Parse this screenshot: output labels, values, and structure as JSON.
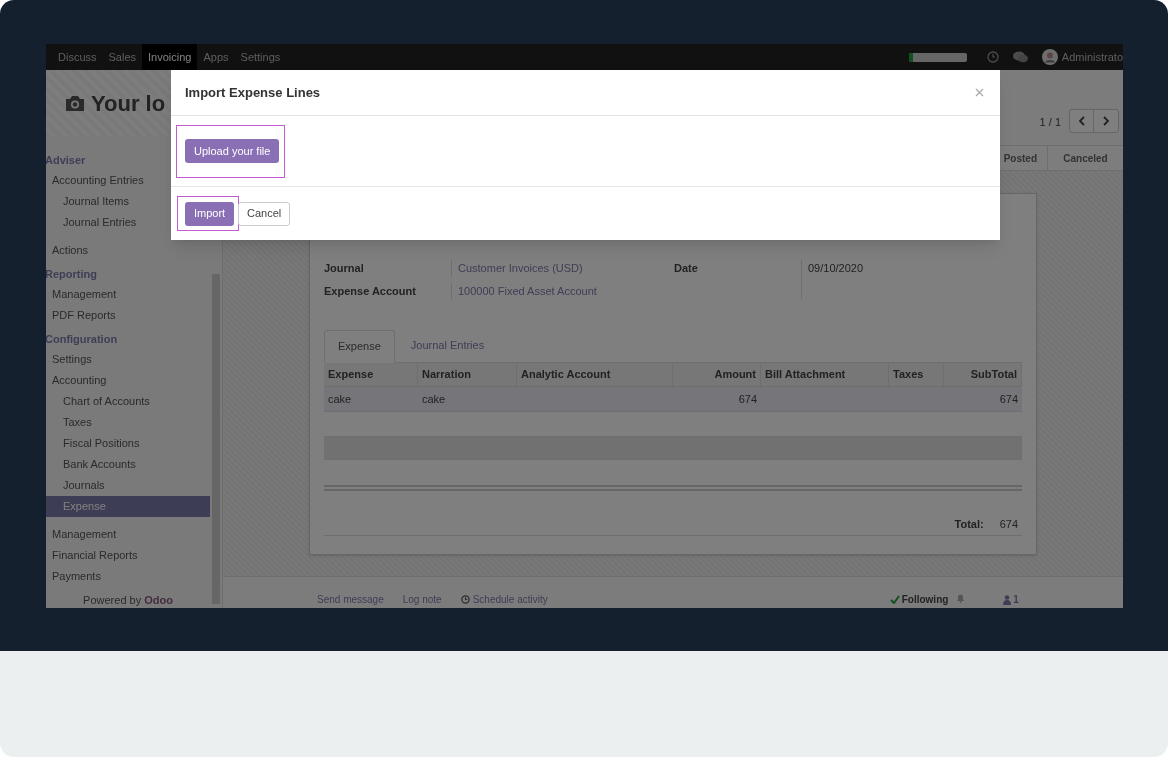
{
  "navbar": {
    "apps": [
      {
        "label": "Discuss",
        "selected": false
      },
      {
        "label": "Sales",
        "selected": false
      },
      {
        "label": "Invoicing",
        "selected": true
      },
      {
        "label": "Apps",
        "selected": false
      },
      {
        "label": "Settings",
        "selected": false
      }
    ],
    "progress": {
      "level": 0.07
    },
    "user": "Administrato"
  },
  "logo_text": "Your lo",
  "sidebar": {
    "sections": [
      {
        "title": "Adviser",
        "items": [
          {
            "label": "Accounting Entries",
            "selected": false,
            "children": [
              {
                "label": "Journal Items",
                "selected": false
              },
              {
                "label": "Journal Entries",
                "selected": false
              }
            ]
          },
          {
            "label": "Actions",
            "selected": false
          }
        ]
      },
      {
        "title": "Reporting",
        "items": [
          {
            "label": "Management",
            "selected": false
          },
          {
            "label": "PDF Reports",
            "selected": false
          }
        ]
      },
      {
        "title": "Configuration",
        "items": [
          {
            "label": "Settings",
            "selected": false
          },
          {
            "label": "Accounting",
            "selected": false,
            "children": [
              {
                "label": "Chart of Accounts",
                "selected": false
              },
              {
                "label": "Taxes",
                "selected": false
              },
              {
                "label": "Fiscal Positions",
                "selected": false
              },
              {
                "label": "Bank Accounts",
                "selected": false
              },
              {
                "label": "Journals",
                "selected": false
              },
              {
                "label": "Expense",
                "selected": true
              }
            ]
          },
          {
            "label": "Management",
            "selected": false
          },
          {
            "label": "Financial Reports",
            "selected": false
          },
          {
            "label": "Payments",
            "selected": false
          }
        ]
      }
    ],
    "footer_text": "Powered by",
    "footer_brand": "Odoo"
  },
  "pager": "1 / 1",
  "stages": [
    {
      "label": "Posted",
      "selected": false
    },
    {
      "label": "Canceled",
      "selected": false
    }
  ],
  "form": {
    "left_fields": [
      {
        "label": "Journal",
        "value": "Customer Invoices (USD)"
      },
      {
        "label": "Expense Account",
        "value": "100000 Fixed Asset Account"
      }
    ],
    "right_fields": [
      {
        "label": "Date",
        "value": "09/10/2020"
      }
    ],
    "tabs": [
      {
        "label": "Expense",
        "selected": true
      },
      {
        "label": "Journal Entries",
        "selected": false
      }
    ],
    "table": {
      "columns": [
        {
          "label": "Expense",
          "kind": "text"
        },
        {
          "label": "Narration",
          "kind": "text"
        },
        {
          "label": "Analytic Account",
          "kind": "text"
        },
        {
          "label": "Amount",
          "kind": "number"
        },
        {
          "label": "Bill Attachment",
          "kind": "text"
        },
        {
          "label": "Taxes",
          "kind": "text"
        },
        {
          "label": "SubTotal",
          "kind": "number"
        }
      ],
      "rows": [
        {
          "cells": [
            "cake",
            "cake",
            null,
            "674",
            null,
            null,
            "674"
          ]
        }
      ]
    },
    "total_label": "Total:",
    "total_value": "674"
  },
  "chatter": {
    "actions": [
      {
        "label": "Send message",
        "kind": "plain"
      },
      {
        "label": "Log note",
        "kind": "plain"
      },
      {
        "label": "Schedule activity",
        "kind": "clock"
      }
    ],
    "following": "Following",
    "followers": "1"
  },
  "modal": {
    "title": "Import Expense Lines",
    "upload": {
      "label": "Upload your file",
      "highlighted": true
    },
    "buttons": [
      {
        "label": "Import",
        "kind": "primary",
        "highlighted": true
      },
      {
        "label": "Cancel",
        "kind": "secondary",
        "highlighted": false
      }
    ]
  }
}
